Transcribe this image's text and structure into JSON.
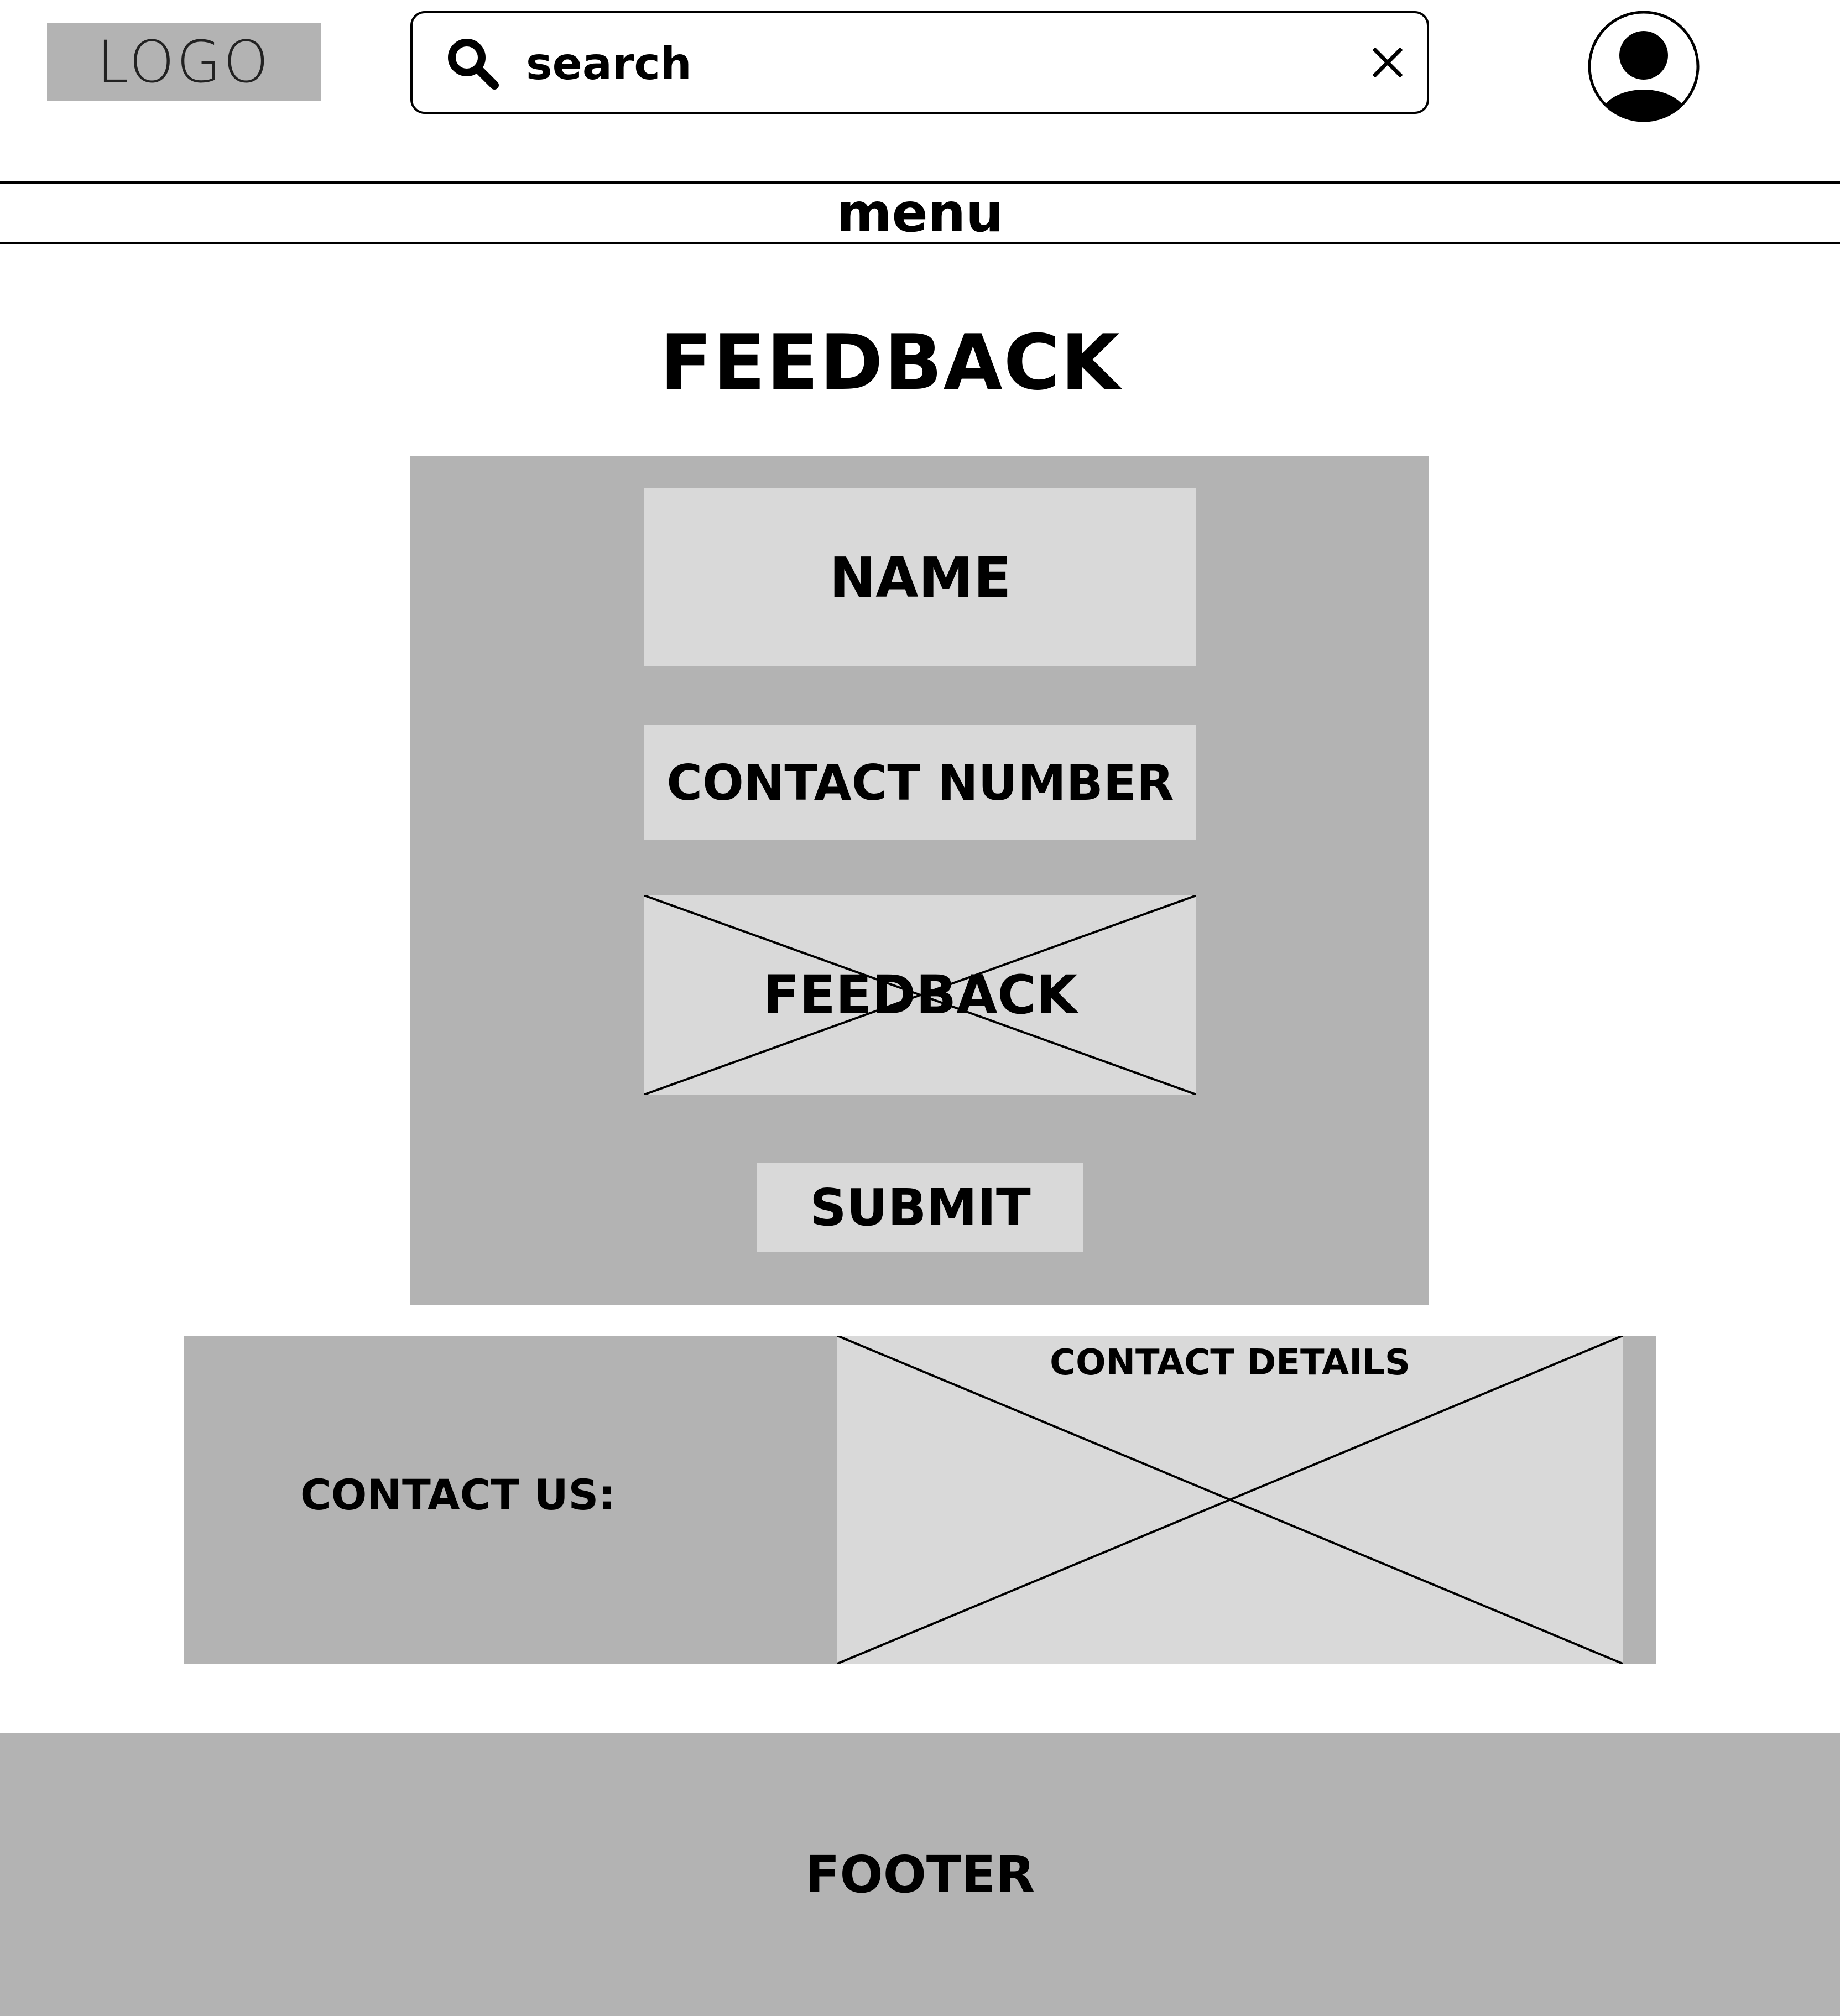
{
  "header": {
    "logo_text": "LOGO",
    "search": {
      "value": "search",
      "search_icon": "search-icon",
      "clear_icon": "close-icon"
    },
    "avatar_icon": "user-avatar-icon"
  },
  "nav": {
    "menu_label": "menu"
  },
  "page": {
    "title": "FEEDBACK"
  },
  "form": {
    "name_label": "NAME",
    "contact_number_label": "CONTACT NUMBER",
    "feedback_label": "FEEDBACK",
    "submit_label": "SUBMIT"
  },
  "contact": {
    "heading": "CONTACT US:",
    "details_label": "CONTACT DETAILS"
  },
  "footer": {
    "label": "FOOTER"
  },
  "colors": {
    "panel_gray": "#b3b3b3",
    "field_gray": "#d9d9d9",
    "outline": "#000000"
  }
}
